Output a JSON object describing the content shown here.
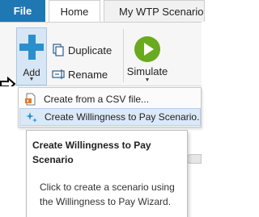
{
  "tabs": {
    "file": "File",
    "home": "Home",
    "wtp": "My WTP Scenario S"
  },
  "ribbon": {
    "add": "Add",
    "duplicate": "Duplicate",
    "rename": "Rename",
    "simulate": "Simulate"
  },
  "menu": {
    "items": [
      {
        "label": "Create from a CSV file...",
        "icon": "csv-file-icon"
      },
      {
        "label": "Create Willingness to Pay Scenario...",
        "icon": "sparkle-icon"
      }
    ]
  },
  "tooltip": {
    "title": "Create Willingness to Pay Scenario",
    "body": "Click to create a scenario using the Willingness to Pay Wizard."
  },
  "background": {
    "left_fragment": "M",
    "right_fragment": "rio"
  },
  "colors": {
    "accent": "#1f78b4",
    "add_icon": "#2a8fcc",
    "simulate_icon": "#6aaa1e",
    "highlight": "#dbe9f6"
  }
}
